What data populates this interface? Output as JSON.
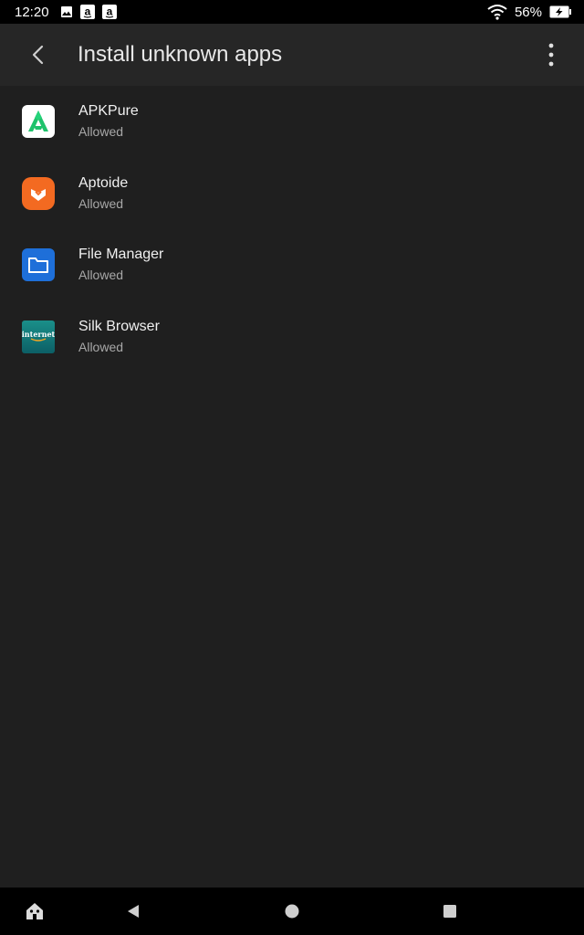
{
  "status_bar": {
    "time": "12:20",
    "battery_percent": "56%",
    "icons": [
      "image-icon",
      "amazon-icon",
      "amazon-icon",
      "wifi-icon",
      "battery-charging-icon"
    ]
  },
  "app_bar": {
    "title": "Install unknown apps",
    "back_icon": "back-arrow-icon",
    "menu_icon": "more-vertical-icon"
  },
  "apps": [
    {
      "name": "APKPure",
      "status": "Allowed",
      "icon": "apkpure-icon"
    },
    {
      "name": "Aptoide",
      "status": "Allowed",
      "icon": "aptoide-icon"
    },
    {
      "name": "File Manager",
      "status": "Allowed",
      "icon": "folder-icon"
    },
    {
      "name": "Silk Browser",
      "status": "Allowed",
      "icon": "silk-browser-icon",
      "icon_text": "internet"
    }
  ],
  "nav_bar": {
    "icons": [
      "home-icon",
      "back-triangle-icon",
      "home-circle-icon",
      "recents-square-icon"
    ]
  },
  "colors": {
    "background": "#1f1f1f",
    "app_bar": "#262626",
    "status_bar": "#000000",
    "secondary_text": "#a8a8a8"
  }
}
